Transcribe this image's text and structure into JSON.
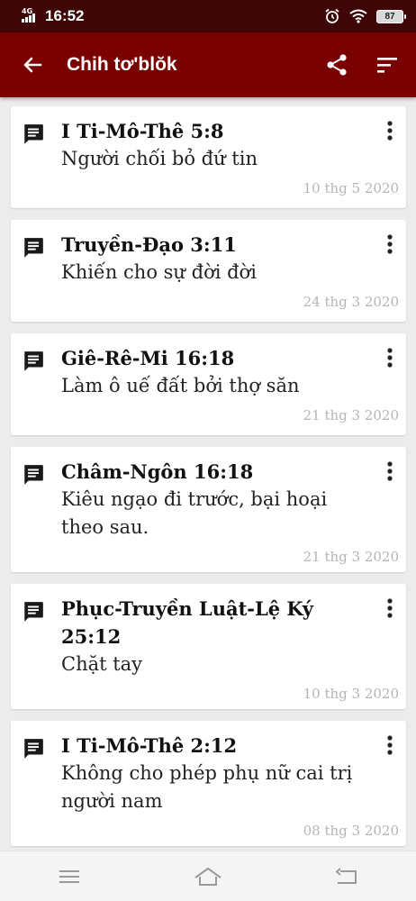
{
  "status_bar": {
    "network": "4G",
    "time": "16:52",
    "battery": "87"
  },
  "app_bar": {
    "title": "Chih tơ'blŏk",
    "back_icon": "arrow-left-icon",
    "share_icon": "share-icon",
    "sort_icon": "sort-icon"
  },
  "notes": [
    {
      "ref": "I Ti-Mô-Thê 5:8",
      "text": "Người chối bỏ đứ tin",
      "date": "10 thg 5 2020"
    },
    {
      "ref": "Truyền-Đạo 3:11",
      "text": "Khiến cho sự đời đời",
      "date": "24 thg 3 2020"
    },
    {
      "ref": "Giê-Rê-Mi 16:18",
      "text": "Làm ô uế đất bởi thợ săn",
      "date": "21 thg 3 2020"
    },
    {
      "ref": "Châm-Ngôn 16:18",
      "text": "Kiêu ngạo đi trước, bại hoại theo sau.",
      "date": "21 thg 3 2020"
    },
    {
      "ref": "Phục-Truyền Luật-Lệ Ký 25:12",
      "text": "Chặt tay",
      "date": "10 thg 3 2020"
    },
    {
      "ref": "I Ti-Mô-Thê 2:12",
      "text": "Không cho phép phụ nữ cai trị người nam",
      "date": "08 thg 3 2020"
    }
  ],
  "colors": {
    "status_bar": "#3e0606",
    "app_bar": "#7a0000",
    "background": "#ececec"
  }
}
